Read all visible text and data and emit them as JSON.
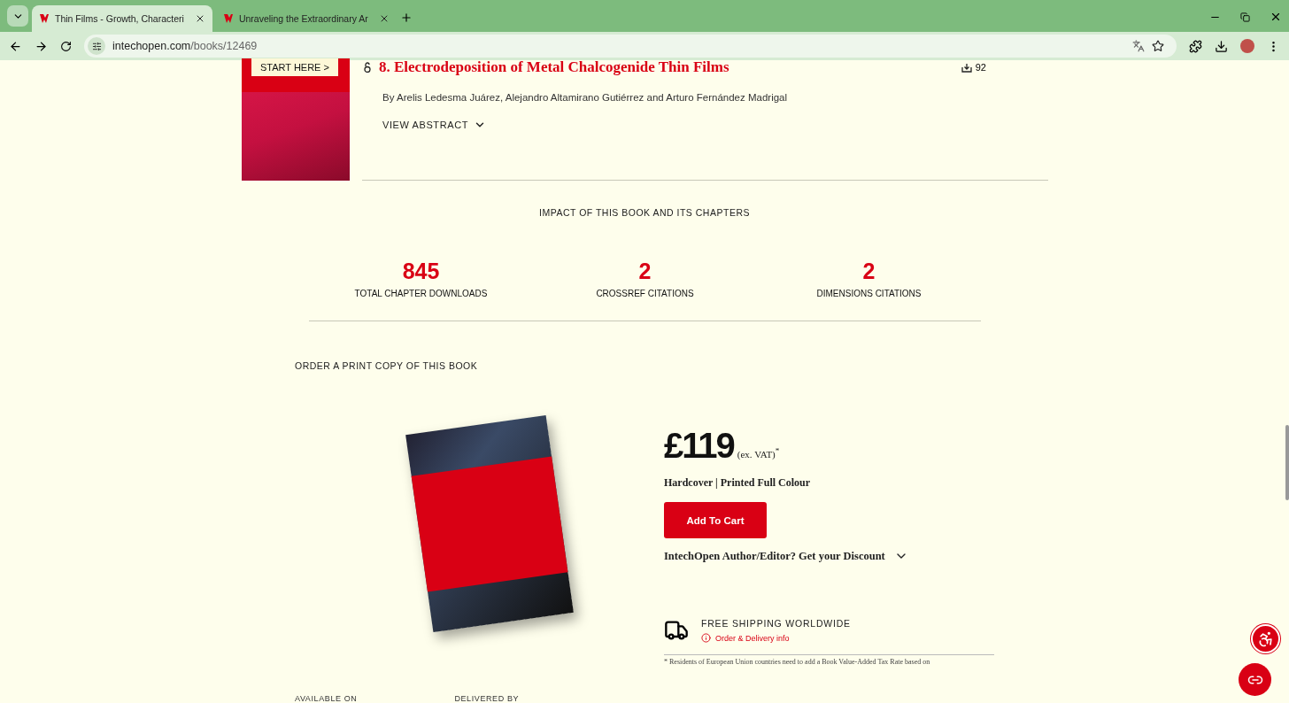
{
  "browser": {
    "tabs": [
      {
        "title": "Thin Films - Growth, Characteri",
        "selected": true
      },
      {
        "title": "Unraveling the Extraordinary Ar",
        "selected": false
      }
    ],
    "url_host": "intechopen.com",
    "url_path": "/books/12469"
  },
  "chapter": {
    "start_button": "START HERE >",
    "title": "8. Electrodeposition of Metal Chalcogenide Thin Films",
    "downloads": "92",
    "authors": "By Arelis Ledesma Juárez, Alejandro Altamirano Gutiérrez and Arturo Fernández Madrigal",
    "view_abstract": "VIEW ABSTRACT"
  },
  "impact": {
    "heading": "IMPACT OF THIS BOOK AND ITS CHAPTERS",
    "stats": [
      {
        "value": "845",
        "label": "TOTAL CHAPTER DOWNLOADS"
      },
      {
        "value": "2",
        "label": "CROSSREF CITATIONS"
      },
      {
        "value": "2",
        "label": "DIMENSIONS CITATIONS"
      }
    ]
  },
  "order": {
    "heading": "ORDER A PRINT COPY OF THIS BOOK",
    "price": "£119",
    "price_note": "(ex. VAT)$^{*}$",
    "format": "Hardcover | Printed Full Colour",
    "add_to_cart": "Add To Cart",
    "discount": "IntechOpen Author/Editor? Get your Discount",
    "shipping_title": "FREE SHIPPING WORLDWIDE",
    "delivery_link": "Order & Delivery info",
    "footnote": "* Residents of European Union countries need to add a Book Value-Added Tax Rate based on",
    "available_on": "AVAILABLE ON",
    "delivered_by": "DELIVERED BY"
  }
}
